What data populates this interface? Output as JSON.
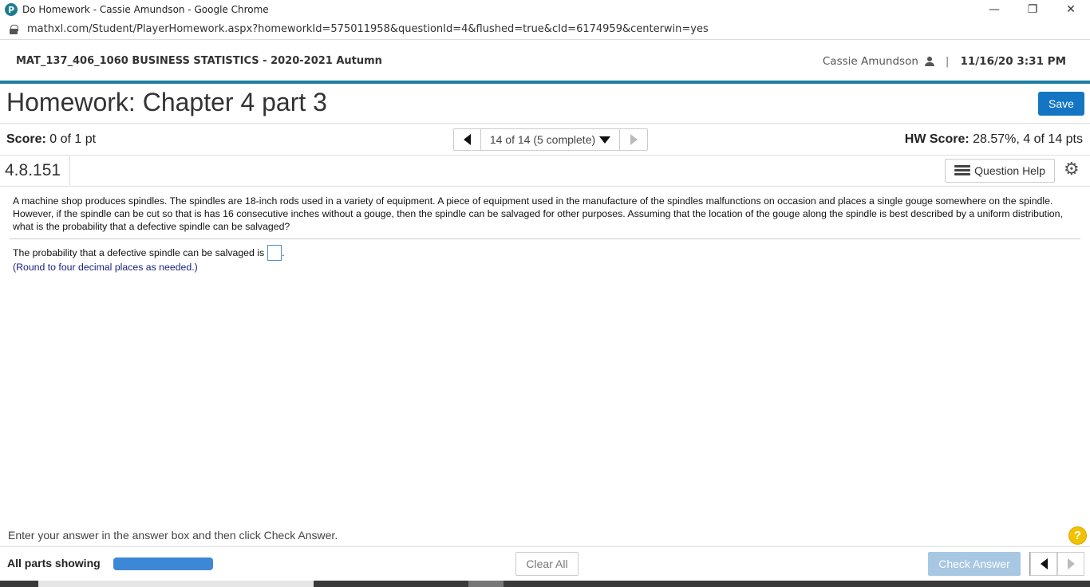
{
  "browser": {
    "window_title": "Do Homework - Cassie Amundson - Google Chrome",
    "favicon_letter": "P",
    "url": "mathxl.com/Student/PlayerHomework.aspx?homeworkId=575011958&questionId=4&flushed=true&cId=6174959&centerwin=yes",
    "controls": {
      "minimize": "—",
      "restore": "❐",
      "close": "✕"
    }
  },
  "course": {
    "name": "MAT_137_406_1060 BUSINESS STATISTICS - 2020-2021 Autumn",
    "user": "Cassie Amundson",
    "separator": "|",
    "datetime": "11/16/20 3:31 PM"
  },
  "homework": {
    "title": "Homework: Chapter 4 part 3",
    "save_label": "Save",
    "score_label": "Score:",
    "score_value": "0 of 1 pt",
    "hw_score_label": "HW Score:",
    "hw_score_value": "28.57%, 4 of 14 pts",
    "question_nav": "14 of 14 (5 complete)"
  },
  "question": {
    "number": "4.8.151",
    "help_label": "Question Help",
    "text": "A machine shop produces spindles. The spindles are 18-inch rods used in a variety of equipment. A piece of equipment used in the manufacture of the spindles malfunctions on occasion and places a single gouge somewhere on the spindle. However, if the spindle can be cut so that is has 16 consecutive inches without a gouge, then the spindle can be salvaged for other purposes. Assuming that the location of the gouge along the spindle is best described by a uniform distribution, what is the probability that a defective spindle can be salvaged?",
    "answer_prompt": "The probability that a defective spindle can be salvaged is",
    "answer_value": "",
    "answer_suffix": ".",
    "round_note": "(Round to four decimal places as needed.)"
  },
  "footer": {
    "instructions": "Enter your answer in the answer box and then click Check Answer.",
    "help_symbol": "?",
    "parts_label": "All parts showing",
    "progress": 1.0,
    "clear_all_label": "Clear All",
    "check_answer_label": "Check Answer"
  },
  "colors": {
    "accent": "#1c7ea1",
    "save_button": "#1475c2",
    "progress_bar": "#3d88d6",
    "check_answer_disabled": "#a7c7e3",
    "help_circle": "#f2c200"
  }
}
